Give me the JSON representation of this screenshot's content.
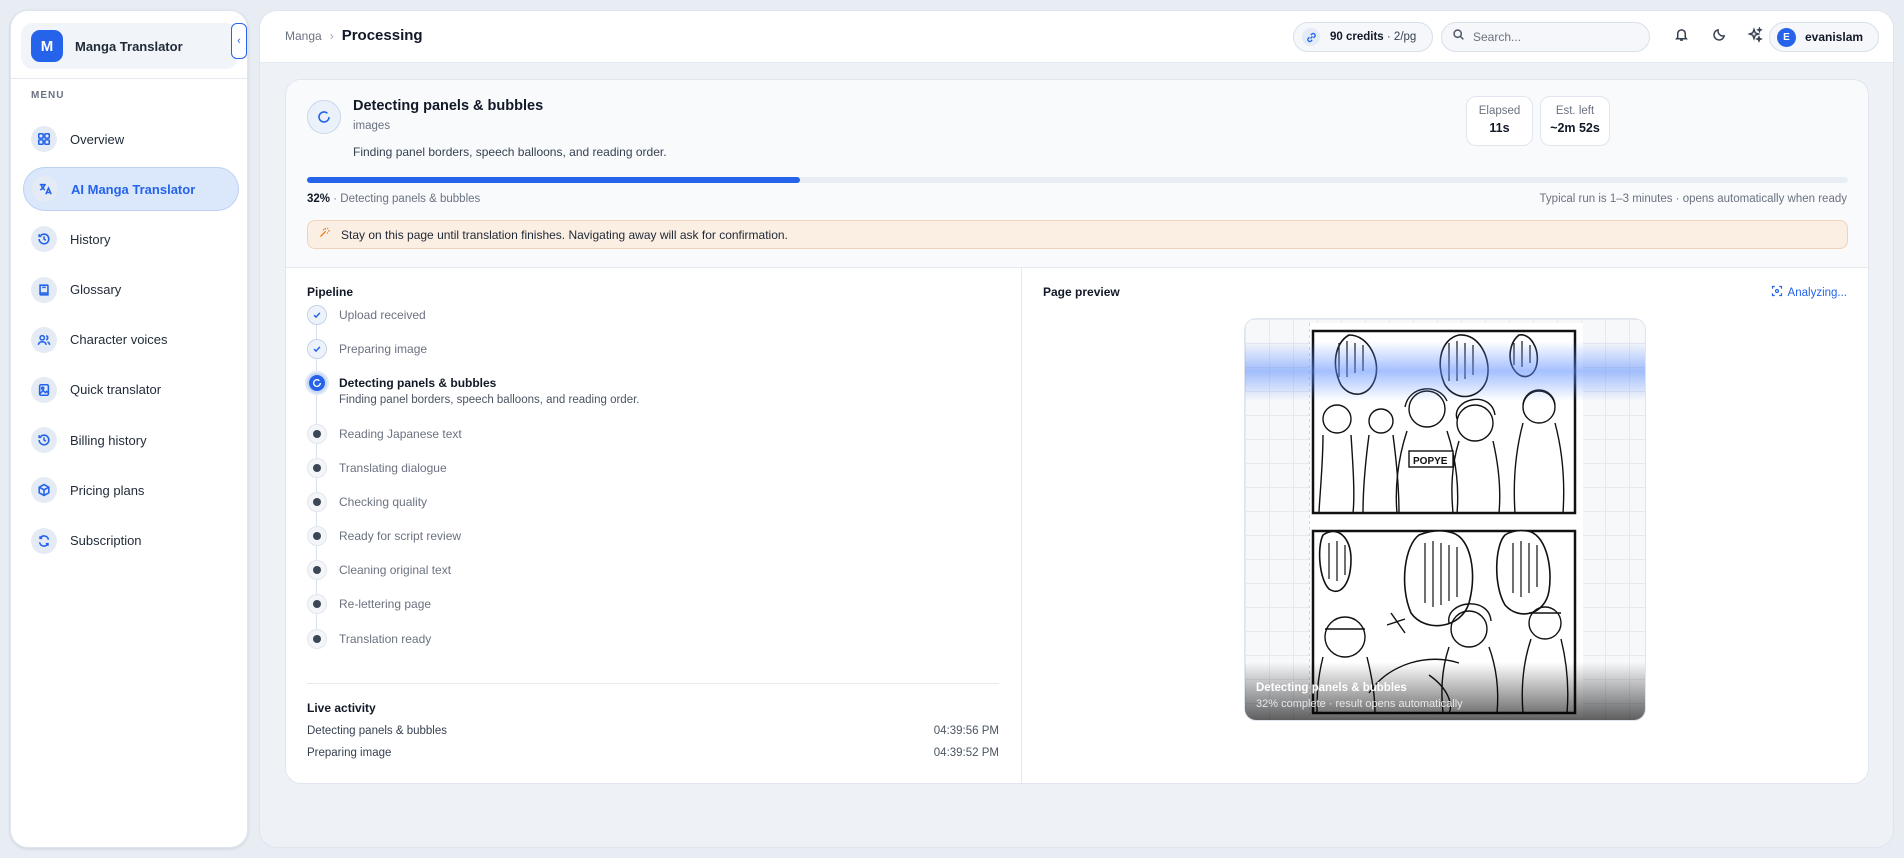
{
  "app": {
    "logo_letter": "M",
    "name": "Manga Translator"
  },
  "sidebar": {
    "menu_heading": "MENU",
    "items": [
      {
        "label": "Overview",
        "icon": "grid-icon"
      },
      {
        "label": "AI Manga Translator",
        "icon": "translate-icon",
        "active": true
      },
      {
        "label": "History",
        "icon": "history-icon"
      },
      {
        "label": "Glossary",
        "icon": "book-icon"
      },
      {
        "label": "Character voices",
        "icon": "users-icon"
      },
      {
        "label": "Quick translator",
        "icon": "image-icon"
      },
      {
        "label": "Billing history",
        "icon": "history-icon"
      },
      {
        "label": "Pricing plans",
        "icon": "box-icon"
      },
      {
        "label": "Subscription",
        "icon": "refresh-icon"
      }
    ]
  },
  "header": {
    "breadcrumb_parent": "Manga",
    "breadcrumb_current": "Processing",
    "credits_amount": "90 credits",
    "credits_rate": "· 2/pg",
    "search_placeholder": "Search...",
    "user_initial": "E",
    "user_name": "evanislam"
  },
  "status": {
    "title": "Detecting panels & bubbles",
    "subtitle": "images",
    "description": "Finding panel borders, speech balloons, and reading order.",
    "elapsed_label": "Elapsed",
    "elapsed_value": "11s",
    "est_label": "Est. left",
    "est_value": "~2m 52s",
    "progress_percent": 32,
    "progress_text": "32%",
    "progress_stage": "· Detecting panels & bubbles",
    "progress_note": "Typical run is 1–3 minutes · opens automatically when ready",
    "warning": "Stay on this page until translation finishes. Navigating away will ask for confirmation."
  },
  "pipeline": {
    "title": "Pipeline",
    "steps": [
      {
        "label": "Upload received",
        "state": "done"
      },
      {
        "label": "Preparing image",
        "state": "done"
      },
      {
        "label": "Detecting panels & bubbles",
        "state": "active",
        "detail": "Finding panel borders, speech balloons, and reading order."
      },
      {
        "label": "Reading Japanese text",
        "state": "pending"
      },
      {
        "label": "Translating dialogue",
        "state": "pending"
      },
      {
        "label": "Checking quality",
        "state": "pending"
      },
      {
        "label": "Ready for script review",
        "state": "pending"
      },
      {
        "label": "Cleaning original text",
        "state": "pending"
      },
      {
        "label": "Re-lettering page",
        "state": "pending"
      },
      {
        "label": "Translation ready",
        "state": "pending"
      }
    ]
  },
  "activity": {
    "title": "Live activity",
    "rows": [
      {
        "label": "Detecting panels & bubbles",
        "time": "04:39:56 PM"
      },
      {
        "label": "Preparing image",
        "time": "04:39:52 PM"
      }
    ]
  },
  "preview": {
    "title": "Page preview",
    "status": "Analyzing...",
    "overlay_title": "Detecting panels & bubbles",
    "overlay_sub": "32% complete · result opens automatically"
  }
}
